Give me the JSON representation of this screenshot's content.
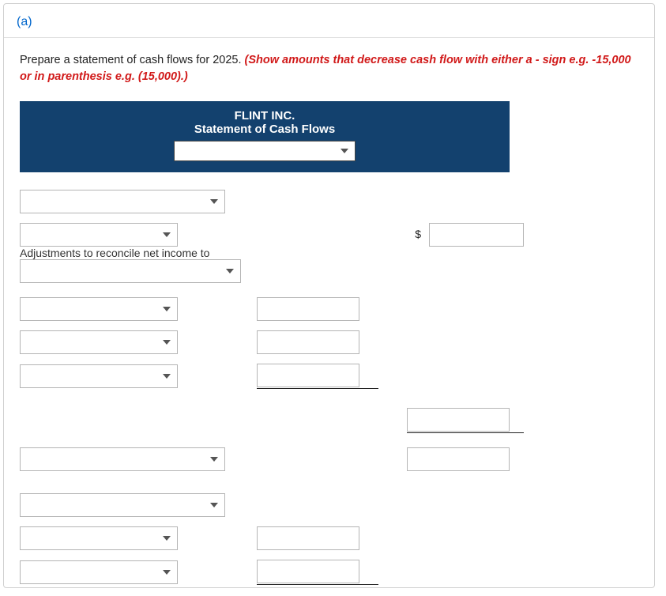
{
  "part_label": "(a)",
  "instruction_plain": "Prepare a statement of cash flows for 2025. ",
  "instruction_red": "(Show amounts that decrease cash flow with either a - sign e.g. -15,000 or in parenthesis e.g. (15,000).)",
  "banner": {
    "company": "FLINT INC.",
    "title": "Statement of Cash Flows"
  },
  "adjustments_label": "Adjustments to reconcile net income to",
  "dollar_sign": "$"
}
